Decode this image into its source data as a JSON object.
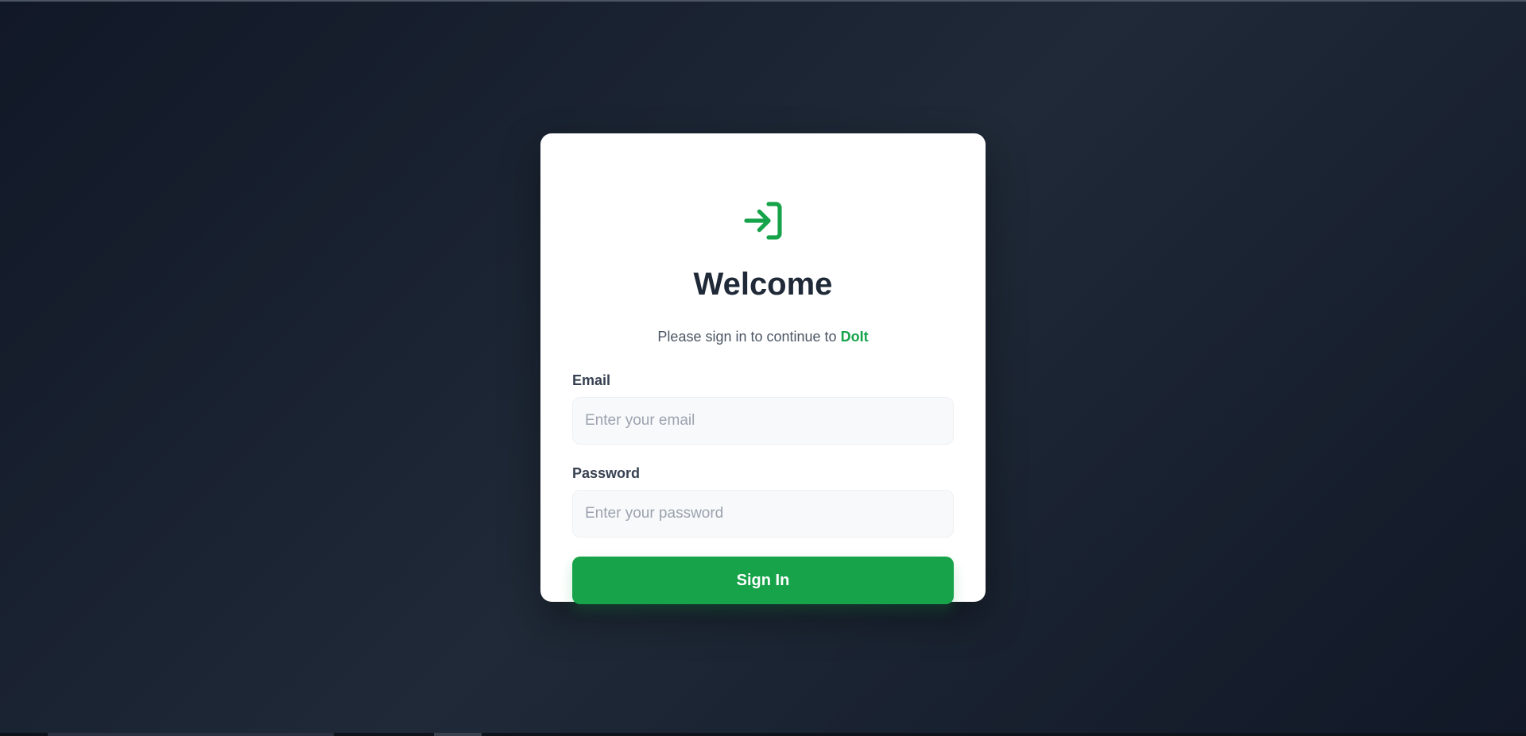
{
  "colors": {
    "accent": "#16a34a",
    "background": "#111827",
    "card": "#ffffff",
    "title": "#1f2937"
  },
  "login": {
    "icon": "sign-in-arrow-icon",
    "title": "Welcome",
    "subtitle_prefix": "Please sign in to continue to ",
    "brand": "DoIt",
    "email": {
      "label": "Email",
      "placeholder": "Enter your email",
      "value": ""
    },
    "password": {
      "label": "Password",
      "placeholder": "Enter your password",
      "value": ""
    },
    "submit_label": "Sign In"
  }
}
